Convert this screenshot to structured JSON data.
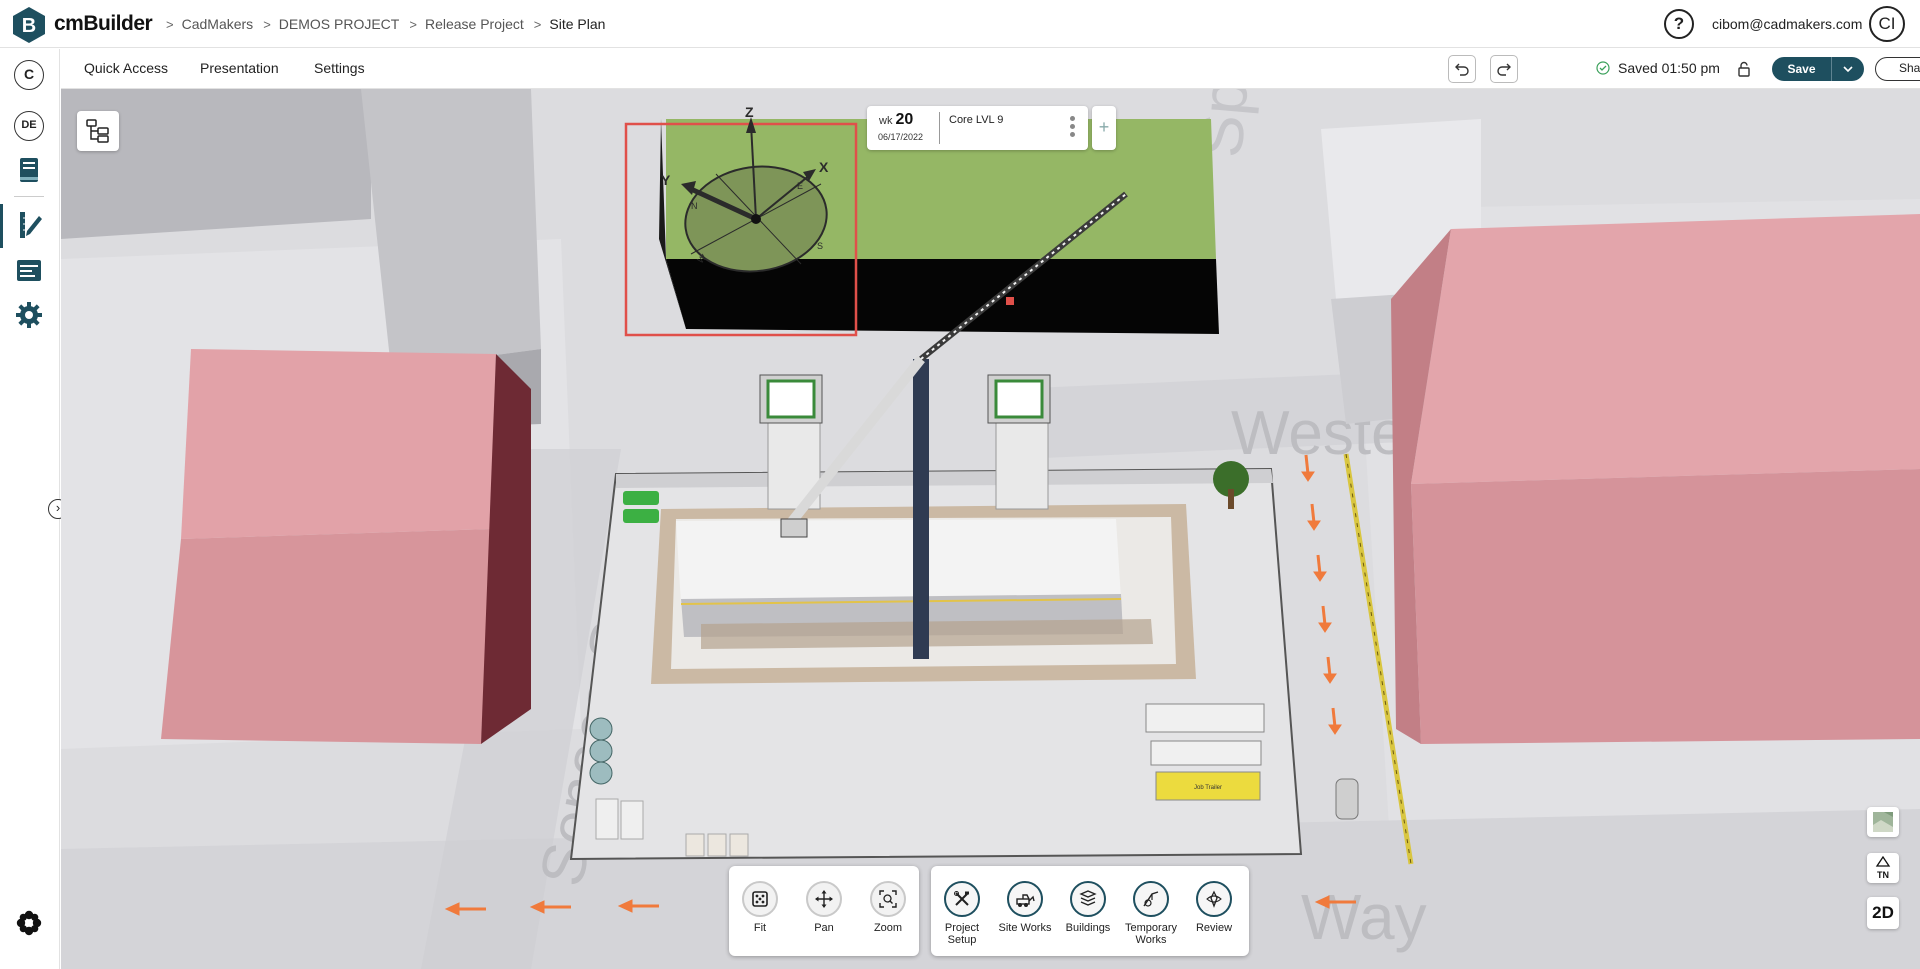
{
  "header": {
    "brand": "cmBuilder",
    "breadcrumbs": [
      "CadMakers",
      "DEMOS PROJECT",
      "Release Project",
      "Site Plan"
    ],
    "help_glyph": "?",
    "email": "cibom@cadmakers.com",
    "avatar_initials": "CI"
  },
  "rail": {
    "top_avatar": "C",
    "workspace_badge": "DE",
    "icons": [
      "book-icon",
      "pencil-ruler-icon",
      "schedule-icon",
      "gear-icon",
      "flower-icon"
    ]
  },
  "toolbar": {
    "menu": [
      "Quick Access",
      "Presentation",
      "Settings"
    ],
    "saved_text": "Saved 01:50 pm",
    "save_label": "Save",
    "share_label": "Share"
  },
  "timeline": {
    "wk_prefix": "wk",
    "week": "20",
    "date": "06/17/2022",
    "label": "Core LVL 9",
    "add_glyph": "+"
  },
  "compass": {
    "axes": [
      "Z",
      "X",
      "Y"
    ],
    "cardinals": [
      "E",
      "S",
      "W",
      "N"
    ]
  },
  "scene_labels": {
    "street_top": "Spr",
    "street_mid": "Weste",
    "street_left": "Seneca St",
    "street_bottom": "Way",
    "trailer_sign": "Job Trailer"
  },
  "nav_tools": [
    {
      "label": "Fit",
      "icon": "fit-icon"
    },
    {
      "label": "Pan",
      "icon": "pan-icon"
    },
    {
      "label": "Zoom",
      "icon": "zoom-icon"
    }
  ],
  "work_tools": [
    {
      "label": "Project Setup",
      "icon": "project-setup-icon"
    },
    {
      "label": "Site Works",
      "icon": "site-works-icon"
    },
    {
      "label": "Buildings",
      "icon": "buildings-icon"
    },
    {
      "label": "Temporary Works",
      "icon": "temporary-works-icon"
    },
    {
      "label": "Review",
      "icon": "review-icon"
    }
  ],
  "view_tools": {
    "tn_label": "TN",
    "mode_label": "2D"
  },
  "colors": {
    "accent": "#1e4f5f",
    "building_pink": "#d7959b",
    "green_roof": "#95b765",
    "arrow": "#f07a3c",
    "highlight": "#e0504a"
  }
}
